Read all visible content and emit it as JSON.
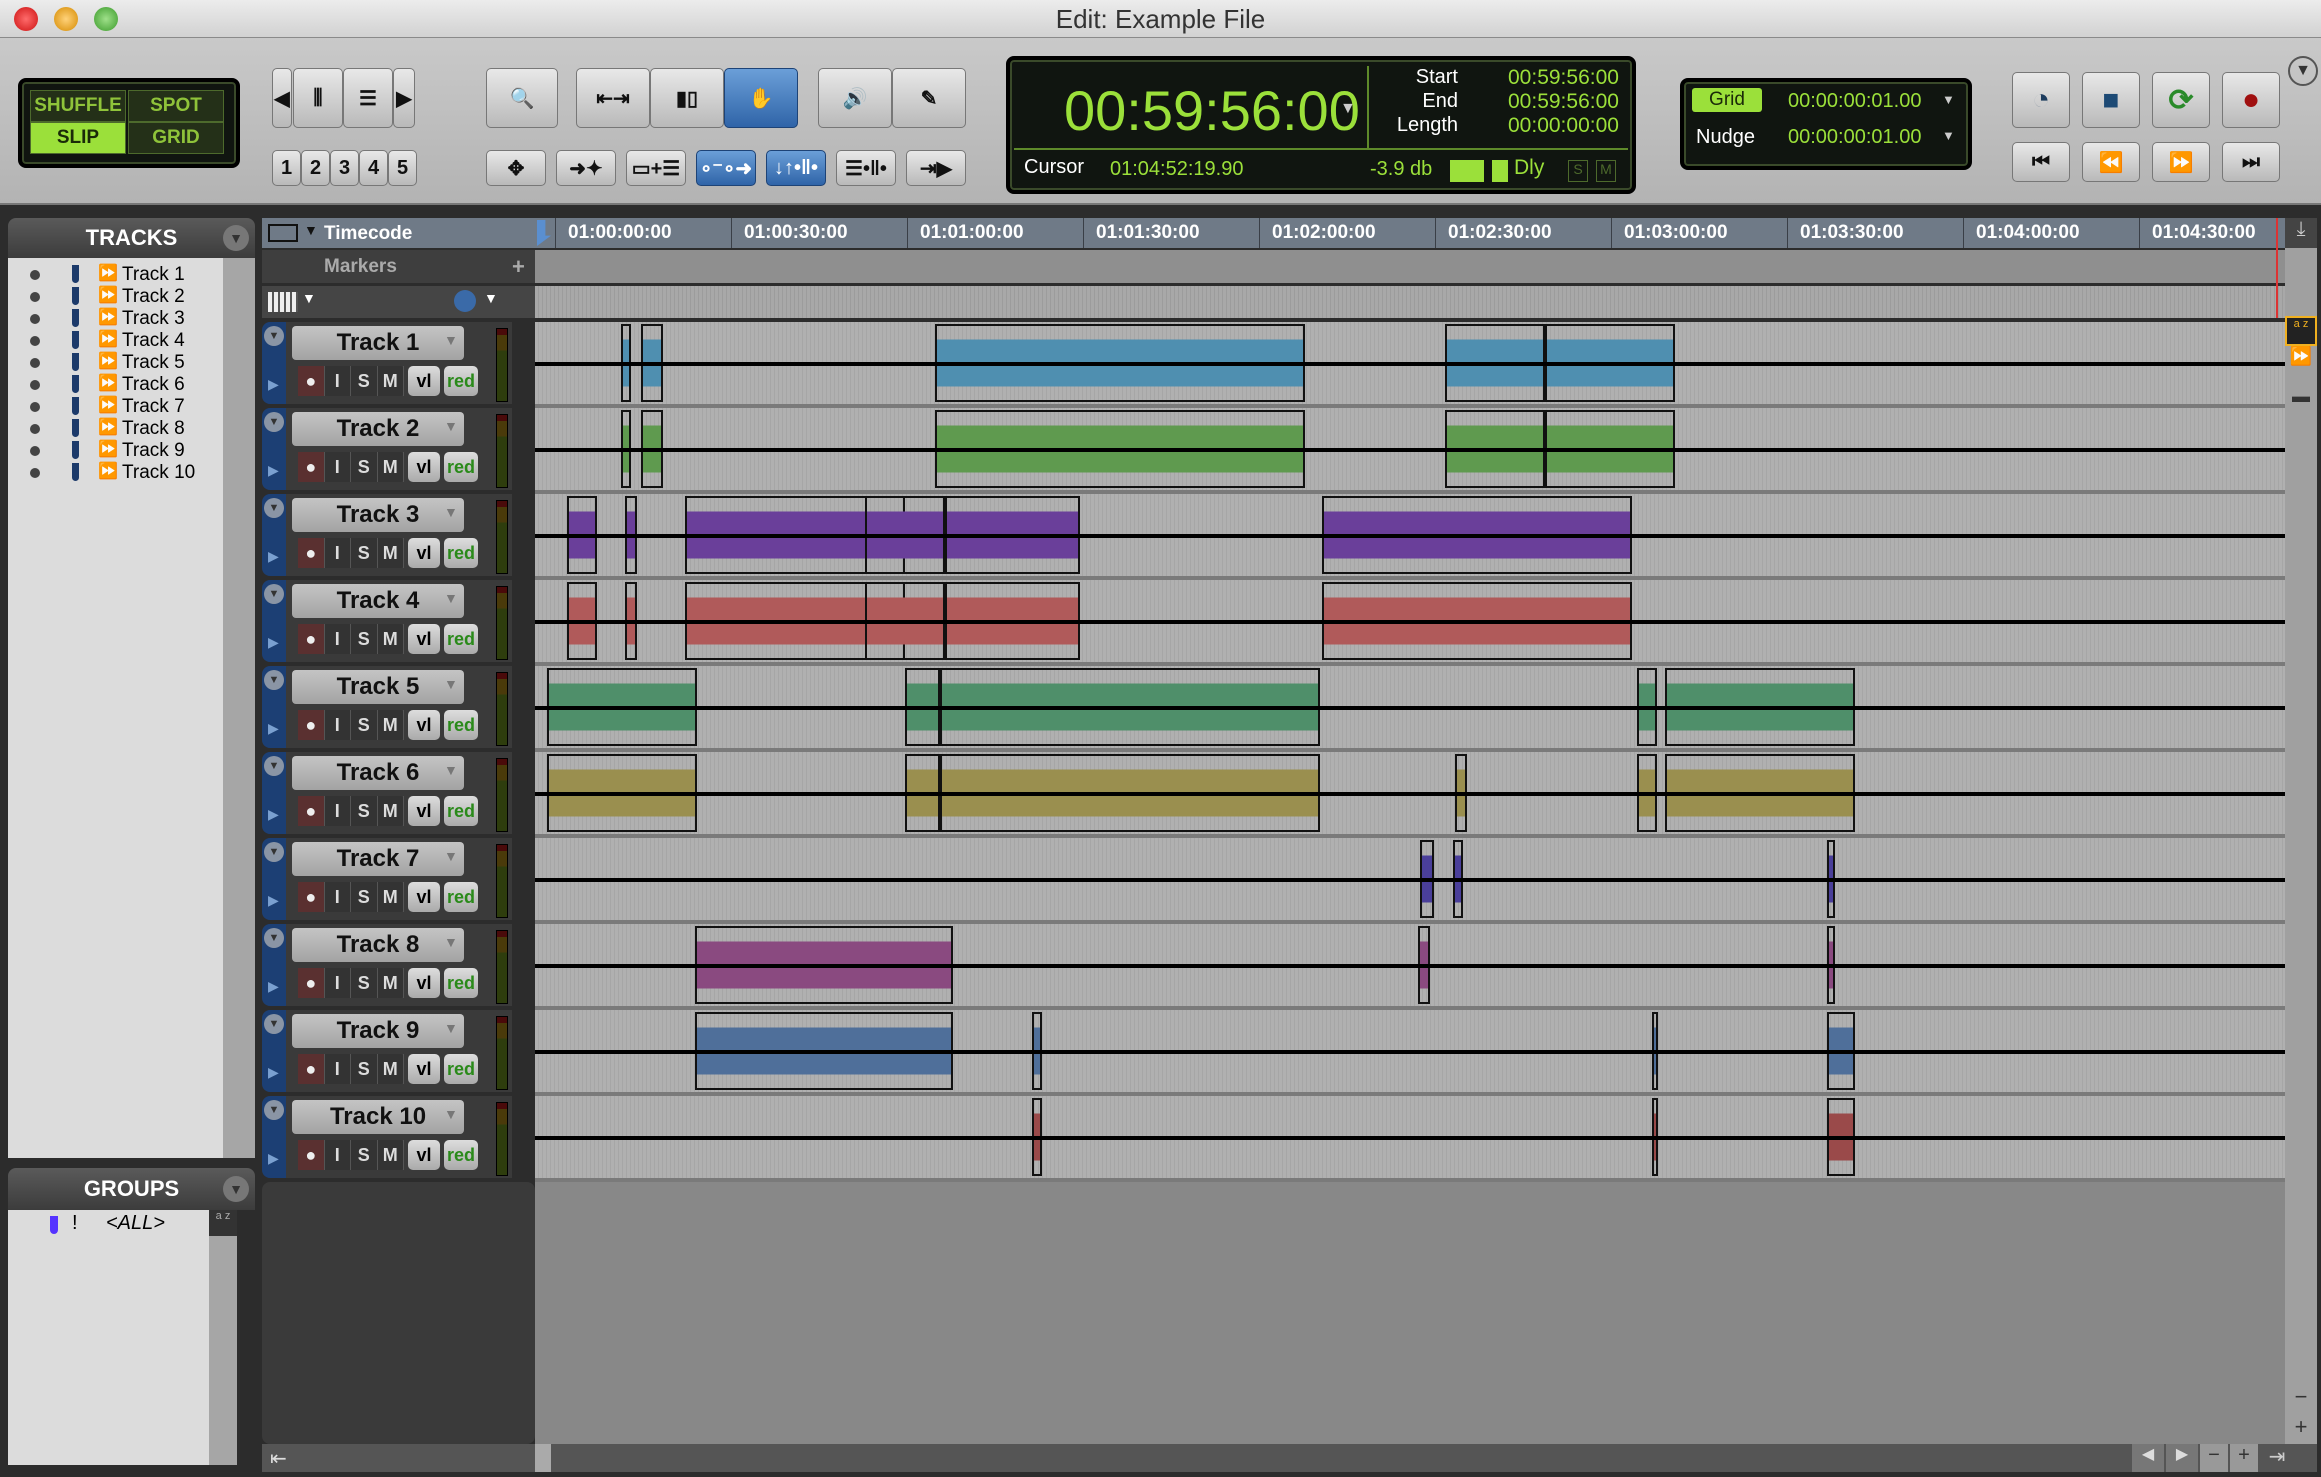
{
  "window": {
    "title": "Edit: Example File"
  },
  "edit_modes": {
    "items": [
      {
        "label": "SHUFFLE",
        "active": false
      },
      {
        "label": "SPOT",
        "active": false
      },
      {
        "label": "SLIP",
        "active": true
      },
      {
        "label": "GRID",
        "active": false
      }
    ]
  },
  "zoom_presets": [
    "1",
    "2",
    "3",
    "4",
    "5"
  ],
  "tools": {
    "edit": [
      "zoomer-icon",
      "trim-icon",
      "selector-icon",
      "grabber-smart-icon",
      "scrub-icon",
      "pencil-icon"
    ],
    "active_tool": "grabber-smart-icon",
    "options": [
      "zoom-toggle-icon",
      "tab-to-transient-icon",
      "mirrored-midi-icon",
      "automation-follows-edit-icon",
      "link-timeline-icon",
      "link-track-edit-icon",
      "insertion-follows-playback-icon"
    ],
    "options_active": [
      "automation-follows-edit-icon",
      "link-timeline-icon"
    ]
  },
  "counter": {
    "main": "00:59:56:00",
    "start_label": "Start",
    "start": "00:59:56:00",
    "end_label": "End",
    "end": "00:59:56:00",
    "length_label": "Length",
    "length": "00:00:00:00",
    "cursor_label": "Cursor",
    "cursor": "01:04:52:19.90",
    "level": "-3.9 db",
    "dly_label": "Dly",
    "s_label": "S",
    "m_label": "M"
  },
  "grid_nudge": {
    "grid_label": "Grid",
    "grid_value": "00:00:00:01.00",
    "nudge_label": "Nudge",
    "nudge_value": "00:00:00:01.00"
  },
  "transport": [
    "online-icon",
    "stop-icon",
    "play-loop-icon",
    "record-icon",
    "return-to-zero-icon",
    "rewind-icon",
    "fast-forward-icon",
    "go-to-end-icon"
  ],
  "tracks_panel": {
    "title": "TRACKS",
    "items": [
      "Track 1",
      "Track 2",
      "Track 3",
      "Track 4",
      "Track 5",
      "Track 6",
      "Track 7",
      "Track 8",
      "Track 9",
      "Track 10"
    ]
  },
  "groups_panel": {
    "title": "GROUPS",
    "items": [
      {
        "flag": "!",
        "name": "<ALL>"
      }
    ]
  },
  "rulers": {
    "timecode_label": "Timecode",
    "markers_label": "Markers",
    "ticks": [
      "01:00:00:00",
      "01:00:30:00",
      "01:01:00:00",
      "01:01:30:00",
      "01:02:00:00",
      "01:02:30:00",
      "01:03:00:00",
      "01:03:30:00",
      "01:04:00:00",
      "01:04:30:00"
    ]
  },
  "track_controls": {
    "rec": "●",
    "input": "I",
    "solo": "S",
    "mute": "M",
    "view": "vl",
    "automation": "red"
  },
  "tracks": [
    {
      "name": "Track 1",
      "color": "#4f8fb0"
    },
    {
      "name": "Track 2",
      "color": "#5f9a4f"
    },
    {
      "name": "Track 3",
      "color": "#6a3f9a"
    },
    {
      "name": "Track 4",
      "color": "#b05a5a"
    },
    {
      "name": "Track 5",
      "color": "#4f8f6a"
    },
    {
      "name": "Track 6",
      "color": "#9a8f4f"
    },
    {
      "name": "Track 7",
      "color": "#4a3f9a"
    },
    {
      "name": "Track 8",
      "color": "#8a4a80"
    },
    {
      "name": "Track 9",
      "color": "#4f6f9a"
    },
    {
      "name": "Track 10",
      "color": "#9a4a4a"
    }
  ]
}
